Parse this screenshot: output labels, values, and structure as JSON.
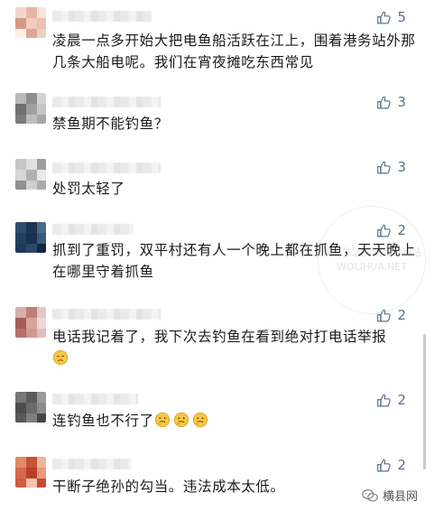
{
  "comments": [
    {
      "avatar_colors": [
        "#f2d7cc",
        "#e4b6a4",
        "#f6e4dc",
        "#d49a84",
        "#f0cdbf",
        "#e9c2b1",
        "#fbefe8",
        "#dba693",
        "#eed0c4"
      ],
      "likes": "5",
      "text": "凌晨一点多开始大把电鱼船活跃在江上，围着港务站外那几条大船电呢。我们在宵夜摊吃东西常见",
      "emoji": 0
    },
    {
      "avatar_colors": [
        "#b9b9b9",
        "#8e8e8e",
        "#d3d3d3",
        "#6f6f6f",
        "#9f9f9f",
        "#c6c6c6",
        "#7c7c7c",
        "#bdbdbd",
        "#a7a7a7"
      ],
      "likes": "3",
      "text": "禁鱼期不能钓鱼？",
      "emoji": 0
    },
    {
      "avatar_colors": [
        "#c5c5c5",
        "#e0e0e0",
        "#9e9e9e",
        "#d6d6d6",
        "#b1b1b1",
        "#e9e9e9",
        "#8f8f8f",
        "#cfcfcf",
        "#a9a9a9"
      ],
      "likes": "3",
      "text": "处罚太轻了",
      "emoji": 0
    },
    {
      "avatar_colors": [
        "#2f4b6e",
        "#1c3553",
        "#4a6a8c",
        "#22405f",
        "#16304d",
        "#3a5a7c",
        "#1f3a58",
        "#2b4868",
        "#13263f"
      ],
      "likes": "2",
      "text": "抓到了重罚，双平村还有人一个晚上都在抓鱼，天天晚上在哪里守着抓鱼",
      "emoji": 0
    },
    {
      "avatar_colors": [
        "#d4b0ad",
        "#c27f7a",
        "#e3c7c4",
        "#a85a55",
        "#d9a29c",
        "#efd8d4",
        "#b86f69",
        "#cf9893",
        "#e6bdb8"
      ],
      "likes": "2",
      "text": "电话我记着了，我下次去钓鱼在看到绝对打电话举报",
      "emoji": 1
    },
    {
      "avatar_colors": [
        "#777777",
        "#5b5b5b",
        "#9a9a9a",
        "#4c4c4c",
        "#6a6a6a",
        "#8c8c8c",
        "#595959",
        "#7f7f7f",
        "#464646"
      ],
      "likes": "2",
      "text": "连钓鱼也不行了",
      "emoji": 3
    },
    {
      "avatar_colors": [
        "#e08a6a",
        "#c6523a",
        "#f0b49a",
        "#d46a4b",
        "#b84028",
        "#e89a7c",
        "#cf5c40",
        "#f3c5ad",
        "#c24b33"
      ],
      "likes": "2",
      "text": "干断子绝孙的勾当。违法成本太低。",
      "emoji": 0
    }
  ],
  "watermark": {
    "line1": "横县生活资讯品牌网站",
    "line2": "WOLIHUA.NET"
  },
  "brand": {
    "name": "横县网"
  }
}
